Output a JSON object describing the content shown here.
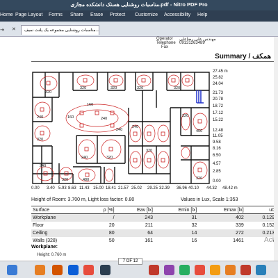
{
  "window": {
    "title": "مناسبات روشنایی هستک دانشکده مجازی.pdf - Nitro PDF Pro"
  },
  "menu": [
    "Home",
    "Page Layout",
    "Forms",
    "Share",
    "Erase",
    "Protect",
    "Customize",
    "Accessibility",
    "Help"
  ],
  "tabs": {
    "doc_tab": "مناسبات روشنایی مجموعه یک پلنت نمیف..."
  },
  "header_block": {
    "operator_label": "Operator",
    "operator_value": "مهندس علی رضاعلی",
    "telephone_label": "Telephone",
    "telephone_value": "09131263489",
    "fax_label": "Fax"
  },
  "summary_title": "Summary / همکف",
  "plan": {
    "x_ticks": [
      "0.00",
      "3.40",
      "5.93",
      "8.63",
      "11.43",
      "15.00",
      "18.41",
      "21.57",
      "25.02",
      "29.25",
      "32.39",
      "36.96",
      "40.10",
      "44.32",
      "48.42 m"
    ],
    "y_ticks": [
      "27.45 m",
      "25.82",
      "24.04",
      "21.73",
      "20.78",
      "18.72",
      "17.12",
      "15.22",
      "12.48",
      "11.05",
      "9.58",
      "8.16",
      "6.50",
      "4.57",
      "2.85",
      "0.00"
    ],
    "contour_labels": [
      "160",
      "240",
      "320",
      "400",
      "480"
    ]
  },
  "info": {
    "room_height": "Height of Room: 3.700 m, Light loss factor: 0.80",
    "units_scale": "Values in Lux, Scale 1:353"
  },
  "table": {
    "headers": [
      "Surface",
      "ρ [%]",
      "Eav [lx]",
      "Emin [lx]",
      "Emax [lx]",
      "u0"
    ],
    "rows": [
      [
        "Workplane",
        "/",
        "243",
        "31",
        "402",
        "0.129"
      ],
      [
        "Floor",
        "20",
        "211",
        "32",
        "339",
        "0.152"
      ],
      [
        "Ceiling",
        "80",
        "64",
        "14",
        "272",
        "0.213"
      ],
      [
        "Walls (328)",
        "50",
        "161",
        "16",
        "1461",
        "/"
      ]
    ]
  },
  "workplane": {
    "title": "Workplane:",
    "height": "Height: 0.760 m"
  },
  "overlay": {
    "activate": "Acti"
  },
  "page_indicator": "7 OF 12",
  "colors": {
    "titlebar": "#34495e",
    "menubar": "#2f3f52",
    "contour_red": "#cc2222",
    "wall": "#111111",
    "fixture": "#cc2222"
  }
}
